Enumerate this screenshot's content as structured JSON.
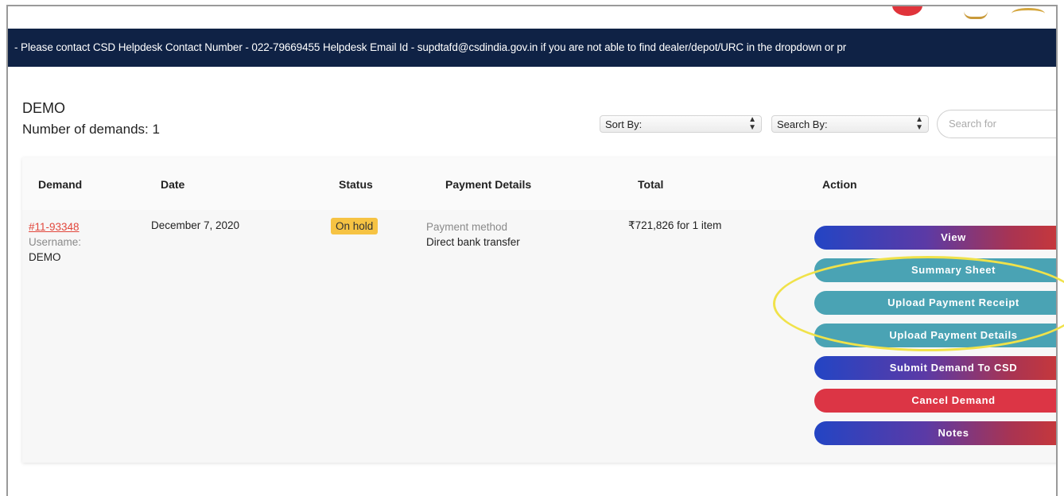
{
  "banner": {
    "text": "- Please contact CSD Helpdesk Contact Number - 022-79669455 Helpdesk Email Id - supdtafd@csdindia.gov.in if you are not able to find dealer/depot/URC in the dropdown or pr"
  },
  "header": {
    "title": "DEMO",
    "count_label": "Number of demands: 1"
  },
  "filters": {
    "sort_label": "Sort By:",
    "search_by_label": "Search By:",
    "search_placeholder": "Search for"
  },
  "table": {
    "columns": [
      "Demand",
      "Date",
      "Status",
      "Payment Details",
      "Total",
      "Action"
    ],
    "rows": [
      {
        "order_id": "#11-93348",
        "username_label": "Username:",
        "username": "DEMO",
        "date": "December 7, 2020",
        "status": "On hold",
        "payment_method_label": "Payment method",
        "payment_method": "Direct bank transfer",
        "total": "₹721,826 for 1 item"
      }
    ]
  },
  "actions": {
    "view": "View",
    "summary_sheet": "Summary Sheet",
    "upload_receipt": "Upload Payment Receipt",
    "upload_details": "Upload Payment Details",
    "submit": "Submit Demand To CSD",
    "cancel": "Cancel Demand",
    "notes": "Notes"
  },
  "colors": {
    "banner_bg": "#0f2245",
    "link": "#e2473c",
    "status_badge": "#f6c343",
    "teal_button": "#4aa3b4",
    "cancel_button": "#dc3545",
    "gradient_start": "#2345c4",
    "gradient_end": "#c8383a",
    "annotation": "#f0e24a"
  }
}
